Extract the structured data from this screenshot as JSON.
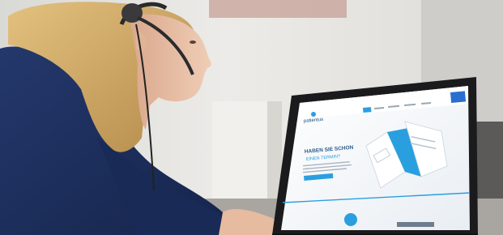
{
  "scene": {
    "description_colors": {
      "wall": "#e4e3df",
      "shirt": "#1e2f5c",
      "hair": "#d3ad6d",
      "skin": "#e8c0a6",
      "laptop": "#1b1b1d",
      "screen": "#f4f7fa",
      "accent": "#2a9fe0"
    }
  },
  "screen_ui": {
    "logo_text": "patientus",
    "nav_items": [
      "",
      "",
      "",
      "",
      "",
      ""
    ],
    "hero_title_line1": "HABEN SIE SCHON",
    "hero_title_line2": "EINEN TERMIN?",
    "cta_label": ""
  }
}
